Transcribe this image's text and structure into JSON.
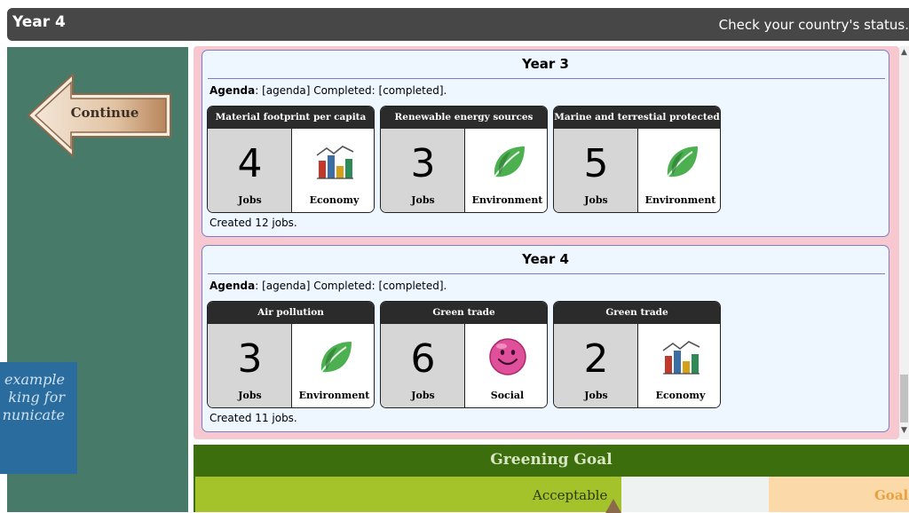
{
  "header": {
    "year": "Year 4",
    "status_link": "Check your country's status."
  },
  "sidebar": {
    "continue_label": "Continue",
    "caption_lines": [
      "example",
      "king for",
      "nunicate"
    ]
  },
  "years": [
    {
      "title": "Year 3",
      "agenda_label": "Agenda",
      "agenda_text": ": [agenda] Completed: [completed].",
      "tiles": [
        {
          "title": "Material footprint per capita",
          "jobs": "4",
          "jobs_label": "Jobs",
          "category": "Economy",
          "icon": "economy-chart-icon"
        },
        {
          "title": "Renewable energy sources",
          "jobs": "3",
          "jobs_label": "Jobs",
          "category": "Environment",
          "icon": "leaf-icon"
        },
        {
          "title": "Marine and terrestial protected",
          "jobs": "5",
          "jobs_label": "Jobs",
          "category": "Environment",
          "icon": "leaf-icon"
        }
      ],
      "created": "Created 12 jobs."
    },
    {
      "title": "Year 4",
      "agenda_label": "Agenda",
      "agenda_text": ": [agenda] Completed: [completed].",
      "tiles": [
        {
          "title": "Air pollution",
          "jobs": "3",
          "jobs_label": "Jobs",
          "category": "Environment",
          "icon": "leaf-icon"
        },
        {
          "title": "Green trade",
          "jobs": "6",
          "jobs_label": "Jobs",
          "category": "Social",
          "icon": "smiley-icon"
        },
        {
          "title": "Green trade",
          "jobs": "2",
          "jobs_label": "Jobs",
          "category": "Economy",
          "icon": "economy-chart-icon"
        }
      ],
      "created": "Created 11 jobs."
    }
  ],
  "goal": {
    "title": "Greening Goal",
    "acceptable_label": "Acceptable",
    "goal_label": "Goal"
  },
  "colors": {
    "topbar": "#474747",
    "sidebar": "#477a69",
    "pink_panel": "#f7c8d0",
    "card_bg": "#eef6ff",
    "goal_header": "#3c6e0e",
    "acceptable_zone": "#a4c22a",
    "goal_zone": "#fcd9a8"
  }
}
